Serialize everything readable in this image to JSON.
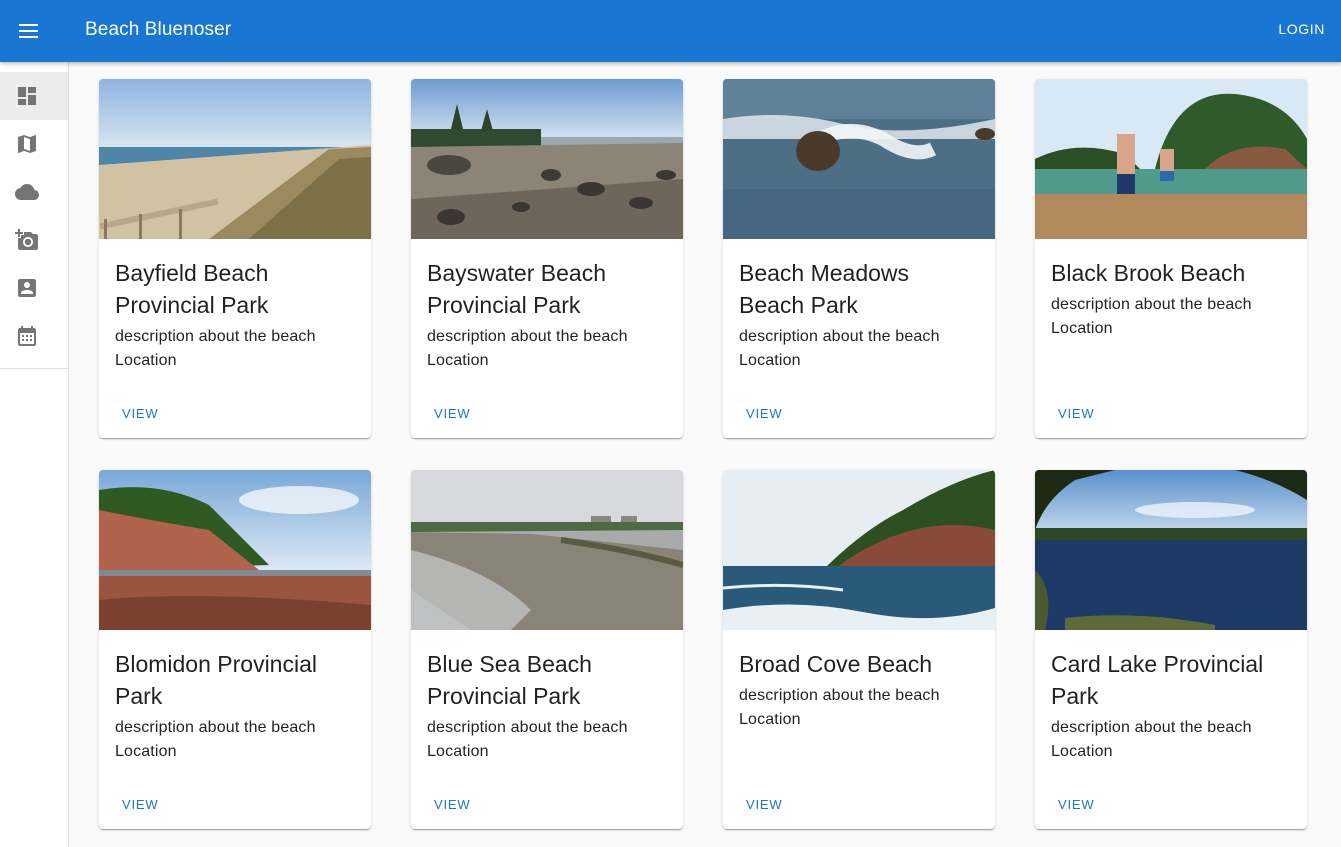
{
  "appbar": {
    "title": "Beach Bluenoser",
    "login_label": "LOGIN",
    "color": "#1976d2"
  },
  "sidebar": {
    "items": [
      {
        "icon": "dashboard-icon",
        "active": true
      },
      {
        "icon": "map-icon",
        "active": false
      },
      {
        "icon": "cloud-icon",
        "active": false
      },
      {
        "icon": "add-a-photo-icon",
        "active": false
      },
      {
        "icon": "account-box-icon",
        "active": false
      },
      {
        "icon": "calendar-icon",
        "active": false
      }
    ]
  },
  "cards": [
    {
      "title": "Bayfield Beach Provincial Park",
      "description": "description about the beach",
      "location": "Location",
      "action": "VIEW"
    },
    {
      "title": "Bayswater Beach Provincial Park",
      "description": "description about the beach",
      "location": "Location",
      "action": "VIEW"
    },
    {
      "title": "Beach Meadows Beach Park",
      "description": "description about the beach",
      "location": "Location",
      "action": "VIEW"
    },
    {
      "title": "Black Brook Beach",
      "description": "description about the beach",
      "location": "Location",
      "action": "VIEW"
    },
    {
      "title": "Blomidon Provincial Park",
      "description": "description about the beach",
      "location": "Location",
      "action": "VIEW"
    },
    {
      "title": "Blue Sea Beach Provincial Park",
      "description": "description about the beach",
      "location": "Location",
      "action": "VIEW"
    },
    {
      "title": "Broad Cove Beach",
      "description": "description about the beach",
      "location": "Location",
      "action": "VIEW"
    },
    {
      "title": "Card Lake Provincial Park",
      "description": "description about the beach",
      "location": "Location",
      "action": "VIEW"
    }
  ]
}
